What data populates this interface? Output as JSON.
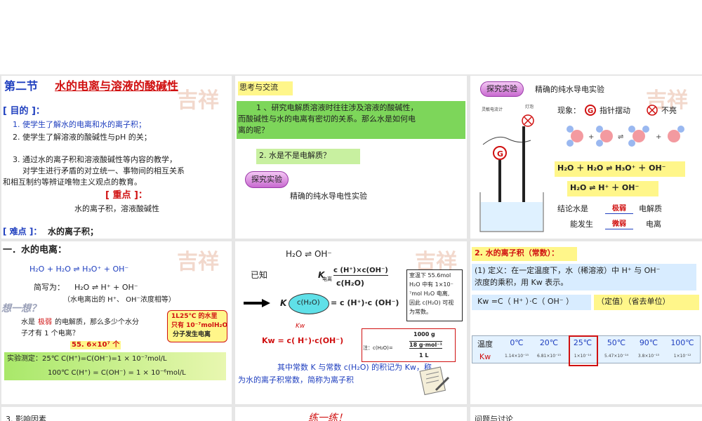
{
  "slide1": {
    "title_prefix": "第二节",
    "title_main": "水的电离与溶液的酸碱性",
    "goals_label": "[ 目的 ]：",
    "goal1": "1. 使学生了解水的电离和水的离子积；",
    "goal2": "2. 使学生了解溶液的酸碱性与pH 的关；",
    "goal3a": "3. 通过水的离子积和溶液酸碱性等内容的教学，",
    "goal3b": "对学生进行矛盾的对立统一、事物间的相互关系",
    "goal3c": "和相互制约等辨证唯物主义观点的教育。",
    "key_label": "[ 重点 ]：",
    "key_text": "水的离子积，溶液酸碱性",
    "difficult_label": "[ 难点 ]：",
    "difficult_text": "水的离子积；"
  },
  "slide2": {
    "heading": "思考与交流",
    "q1a": "1 、研究电解质溶液时往往涉及溶液的酸碱性，",
    "q1b": "而酸碱性与水的电离有密切的关系。那么水是如何电",
    "q1c": "离的呢？",
    "q2": "2. 水是不是电解质？",
    "badge": "探究实验",
    "experiment": "精确的纯水导电性实验"
  },
  "slide3": {
    "badge": "探究实验",
    "title": "精确的纯水导电实验",
    "meter_label": "灵敏电流计",
    "bulb_label": "灯泡",
    "meter_symbol": "G",
    "phenomenon_label": "现象：",
    "needle": "指针摆动",
    "not_lit": "不亮",
    "eq1": "H₂O ＋ H₂O ⇌ H₃O⁺ ＋ OH⁻",
    "eq2": "H₂O ⇌ H⁺ ＋ OH⁻",
    "conclusion_label": "结论",
    "conclusion_a": "水是",
    "blank1": "极弱",
    "conclusion_b": "电解质",
    "conclusion_c": "能发生",
    "blank2": "微弱",
    "conclusion_d": "电离"
  },
  "slide4": {
    "heading": "一．水的电离：",
    "eq": "H₂O + H₂O ⇌ H₃O⁺ + OH⁻",
    "short_label": "简写为：",
    "short_eq": "H₂O ⇌ H⁺ + OH⁻",
    "note": "（水电离出的 H⁺、 OH⁻浓度相等）",
    "think": "想一想？",
    "question_a": "水是",
    "question_weak": "极弱",
    "question_b": "的电解质，那么多少个水分",
    "question_c": "子才有 1 个电离？",
    "answer": "55. 6×10⁷ 个",
    "bubble_a": "1L25℃ 的水里",
    "bubble_b": "只有 10⁻⁷molH₂O",
    "bubble_c": "分子发生电离",
    "measure_a": "实验测定：25℃ C(H⁺)=C(OH⁻)=1 × 10⁻⁷mol/L",
    "measure_b": "100℃ C(H⁺) = C(OH⁻) = 1 × 10⁻⁶mol/L"
  },
  "slide5": {
    "top_eq": "H₂O ⇌ OH⁻",
    "known": "已知",
    "k": "K",
    "k_sub": "电离",
    "frac_num": "c (H⁺)×c(OH⁻)",
    "frac_den": "c(H₂O)",
    "cloud_text": "c(H₂O)",
    "k_eq": "= c (H⁺)·c (OH⁻)",
    "kw_sub": "Kw",
    "kw_eq": "Kw = c( H⁺)·c(OH⁻)",
    "note_a": "室温下 55.6mol",
    "note_b": "H₂O 中有 1×10⁻",
    "note_c": "⁷mol H₂O 电离,",
    "note_d": "因此 c(H₂O) 可视",
    "note_e": "为常数。",
    "calc_top": "1000 g",
    "calc_mid": "18 g·mol⁻¹",
    "calc_bot": "1 L",
    "calc_label": "注：c(H₂O)=",
    "summary_a": "其中常数 K 与常数 c(H₂O) 的积记为 Kw，称",
    "summary_b": "为水的离子积常数，简称为离子积"
  },
  "slide6": {
    "heading": "2. 水的离子积（常数）：",
    "def_a": "(1) 定义：在一定温度下，水（稀溶液）中 H⁺ 与 OH⁻",
    "def_b": "浓度的乘积，用 Kw 表示。",
    "formula": "Kw =C（ H⁺ ）·C（ OH⁻ ）",
    "note": "（定值）（省去单位）",
    "row_label_temp": "温度",
    "row_label_kw": "Kw",
    "temps": [
      "0℃",
      "20℃",
      "25℃",
      "50℃",
      "90℃",
      "100℃"
    ],
    "kws": [
      "1.14×10⁻¹⁵",
      "6.81×10⁻¹⁵",
      "1×10⁻¹⁴",
      "5.47×10⁻¹⁴",
      "3.8×10⁻¹³",
      "1×10⁻¹²"
    ]
  },
  "slide7": {
    "text": "3. 影响因素"
  },
  "slide8": {
    "text": "练一练！"
  },
  "slide9": {
    "text": "问题与讨论"
  }
}
